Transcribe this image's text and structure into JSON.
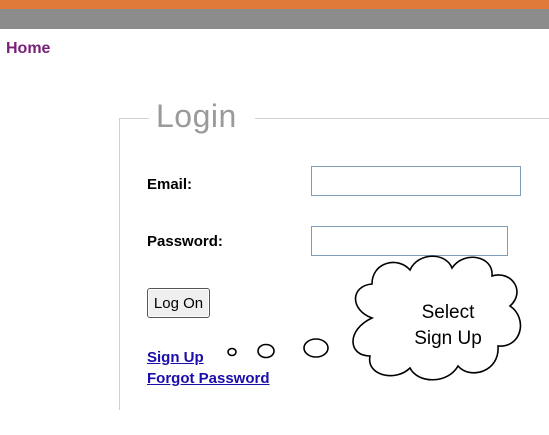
{
  "nav": {
    "home_label": "Home"
  },
  "login": {
    "legend": "Login",
    "email_label": "Email:",
    "email_value": "",
    "password_label": "Password:",
    "password_value": "",
    "logon_button": "Log On",
    "signup_link": "Sign Up",
    "forgot_link": "Forgot Password"
  },
  "callout": {
    "line1": "Select",
    "line2": "Sign Up"
  },
  "colors": {
    "header_orange": "#e07a3a",
    "header_grey": "#8c8c8c",
    "home_link": "#7a1f7a",
    "link_blue": "#1a0dab"
  }
}
